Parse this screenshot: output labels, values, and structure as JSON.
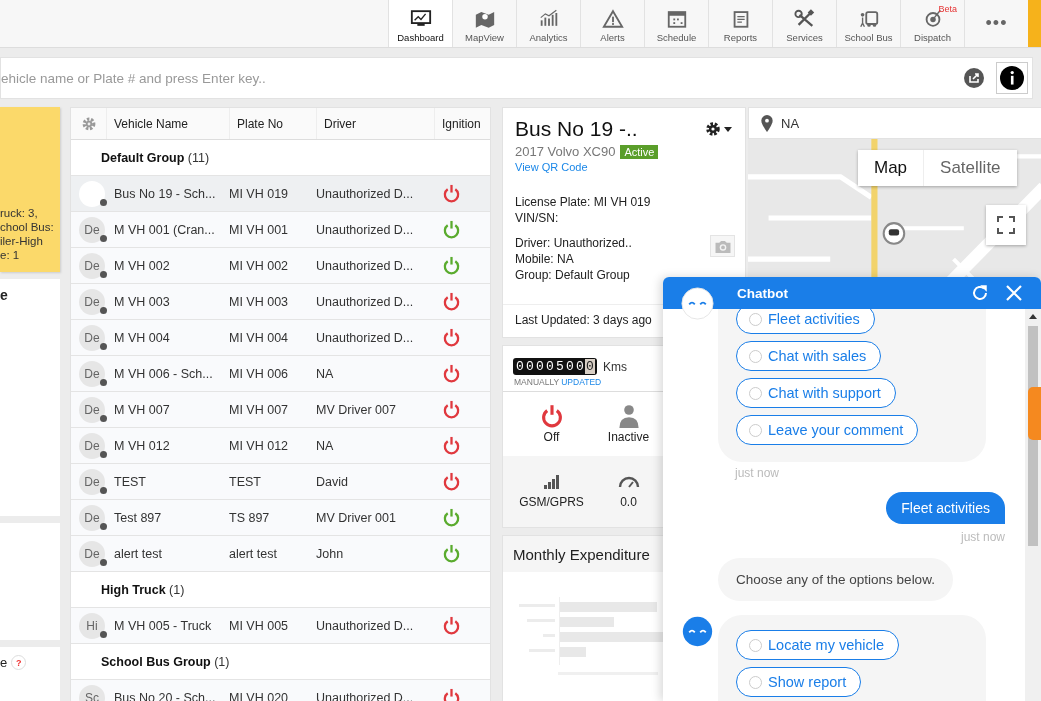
{
  "nav": {
    "items": [
      {
        "label": "Dashboard",
        "selected": true
      },
      {
        "label": "MapView",
        "selected": false
      },
      {
        "label": "Analytics",
        "selected": false
      },
      {
        "label": "Alerts",
        "selected": false
      },
      {
        "label": "Schedule",
        "selected": false
      },
      {
        "label": "Reports",
        "selected": false
      },
      {
        "label": "Services",
        "selected": false
      },
      {
        "label": "School Bus",
        "selected": false
      },
      {
        "label": "Dispatch",
        "selected": false,
        "badge": "Beta"
      }
    ],
    "more": "•••"
  },
  "search": {
    "placeholder": "ehicle name or Plate # and press Enter key.."
  },
  "left_cards": [
    {
      "kind": "summary",
      "lines": [
        "ruck: 3,",
        "chool Bus:",
        "iler-High",
        "e: 1"
      ]
    },
    {
      "kind": "title",
      "title": "e"
    },
    {
      "kind": "blank"
    },
    {
      "kind": "title",
      "title": "e",
      "help": "?"
    }
  ],
  "table": {
    "columns": [
      "Vehicle Name",
      "Plate No",
      "Driver",
      "Ignition"
    ],
    "groups": [
      {
        "name": "Default Group",
        "count": "(11)",
        "rows": [
          {
            "avatar": "",
            "name": "Bus No 19 - Sch...",
            "plate": "MI VH 019",
            "driver": "Unauthorized D...",
            "on": false,
            "selected": true
          },
          {
            "avatar": "De",
            "name": "M VH 001 (Cran...",
            "plate": "MI VH 001",
            "driver": "Unauthorized D...",
            "on": true,
            "selected": false
          },
          {
            "avatar": "De",
            "name": "M VH 002",
            "plate": "MI VH 002",
            "driver": "Unauthorized D...",
            "on": true,
            "selected": false
          },
          {
            "avatar": "De",
            "name": "M VH 003",
            "plate": "MI VH 003",
            "driver": "Unauthorized D...",
            "on": false,
            "selected": false
          },
          {
            "avatar": "De",
            "name": "M VH 004",
            "plate": "MI VH 004",
            "driver": "Unauthorized D...",
            "on": false,
            "selected": false
          },
          {
            "avatar": "De",
            "name": "M VH 006 - Sch...",
            "plate": "MI VH 006",
            "driver": "NA",
            "on": false,
            "selected": false
          },
          {
            "avatar": "De",
            "name": "M VH 007",
            "plate": "MI VH 007",
            "driver": "MV Driver 007",
            "on": false,
            "selected": false
          },
          {
            "avatar": "De",
            "name": "M VH 012",
            "plate": "MI VH 012",
            "driver": "NA",
            "on": false,
            "selected": false
          },
          {
            "avatar": "De",
            "name": "TEST",
            "plate": "TEST",
            "driver": "David",
            "on": false,
            "selected": false
          },
          {
            "avatar": "De",
            "name": "Test 897",
            "plate": "TS 897",
            "driver": "MV Driver 001",
            "on": true,
            "selected": false
          },
          {
            "avatar": "De",
            "name": "alert test",
            "plate": "alert test",
            "driver": "John",
            "on": true,
            "selected": false
          }
        ]
      },
      {
        "name": "High Truck",
        "count": "(1)",
        "rows": [
          {
            "avatar": "Hi",
            "name": "M VH 005 - Truck",
            "plate": "MI VH 005",
            "driver": "Unauthorized D...",
            "on": false,
            "selected": false
          }
        ]
      },
      {
        "name": "School Bus Group",
        "count": "(1)",
        "rows": [
          {
            "avatar": "Sc",
            "name": "Bus No 20 - Sch...",
            "plate": "MI VH 020",
            "driver": "Unauthorized D...",
            "on": false,
            "selected": false
          }
        ]
      }
    ]
  },
  "detail": {
    "title": "Bus No 19 -..",
    "subtitle": "2017 Volvo XC90",
    "status": "Active",
    "link": "View QR Code",
    "lines": [
      "License Plate: MI VH 019",
      "VIN/SN:"
    ],
    "lines2": [
      "Driver: Unauthorized..",
      "Mobile: NA",
      "Group: Default Group"
    ],
    "updated": "Last Updated: 3 days ago"
  },
  "odometer": {
    "digits": "00005000",
    "unit": "Kms",
    "note": "MANUALLY",
    "note_link": "UPDATED"
  },
  "stats": [
    {
      "kind": "ignition",
      "label": "Off",
      "on": false
    },
    {
      "kind": "status",
      "label": "Inactive"
    },
    {
      "kind": "signal",
      "label": "GSM/GPRS"
    },
    {
      "kind": "speed",
      "label": "0.0"
    }
  ],
  "expenditure": {
    "title": "Monthly Expenditure"
  },
  "map": {
    "location": "NA",
    "types": [
      {
        "label": "Map",
        "selected": true
      },
      {
        "label": "Satellite",
        "selected": false
      }
    ]
  },
  "chatbot": {
    "title": "Chatbot",
    "messages": [
      {
        "kind": "options",
        "options": [
          "Fleet activities",
          "Chat with sales",
          "Chat with support",
          "Leave your comment"
        ],
        "time": "just now"
      },
      {
        "kind": "user",
        "text": "Fleet activities",
        "time": "just now"
      },
      {
        "kind": "bot",
        "text": "Choose any of the options below."
      },
      {
        "kind": "options",
        "options": [
          "Locate my vehicle",
          "Show report"
        ]
      }
    ]
  }
}
